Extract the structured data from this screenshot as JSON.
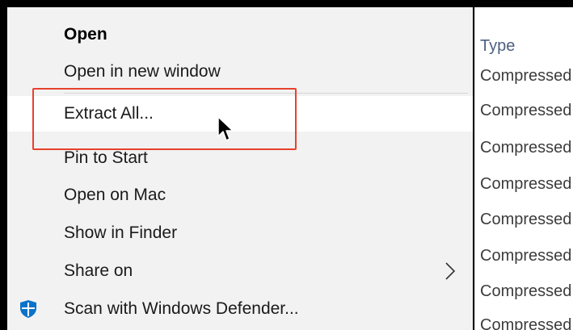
{
  "context_menu": {
    "items": [
      {
        "label": "Open",
        "bold": true
      },
      {
        "label": "Open in new window"
      },
      {
        "label": "Extract All..."
      },
      {
        "label": "Pin to Start"
      },
      {
        "label": "Open on Mac"
      },
      {
        "label": "Show in Finder"
      },
      {
        "label": "Share on",
        "submenu": true,
        "arrow_icon": "chevron-right-icon"
      },
      {
        "label": "Scan with Windows Defender...",
        "icon": "windows-defender-shield-icon"
      }
    ],
    "hovered_item": "Extract All..."
  },
  "file_list": {
    "column_header": "Type",
    "rows": [
      "Compressed",
      "Compressed",
      "Compressed",
      "Compressed",
      "Compressed",
      "Compressed",
      "Compressed",
      "Compressed"
    ]
  },
  "colors": {
    "menu_background": "#f2f2f2",
    "hover_background": "#ffffff",
    "highlight_border": "#e8412c",
    "defender_blue": "#0a72c9",
    "header_text": "#4d6082"
  }
}
